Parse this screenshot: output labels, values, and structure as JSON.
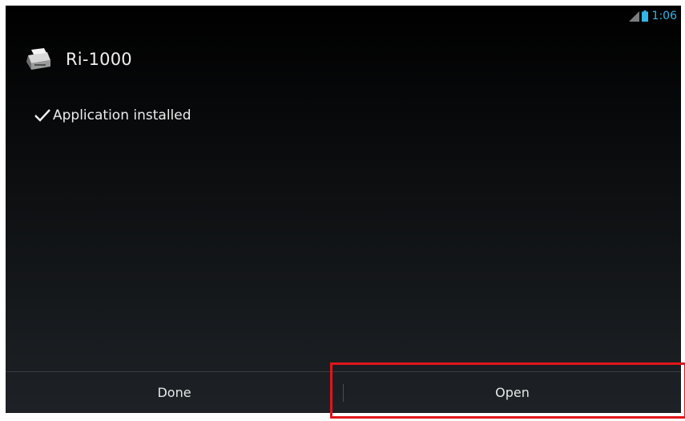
{
  "status_bar": {
    "time": "1:06",
    "signal_icon": "signal-icon",
    "battery_icon": "battery-icon",
    "accent_color": "#33b5e5"
  },
  "app": {
    "title": "Ri-1000",
    "icon": "printer-icon"
  },
  "install_status": {
    "icon": "check-icon",
    "message": "Application installed"
  },
  "buttons": {
    "done_label": "Done",
    "open_label": "Open"
  },
  "colors": {
    "highlight": "#e2151b"
  }
}
